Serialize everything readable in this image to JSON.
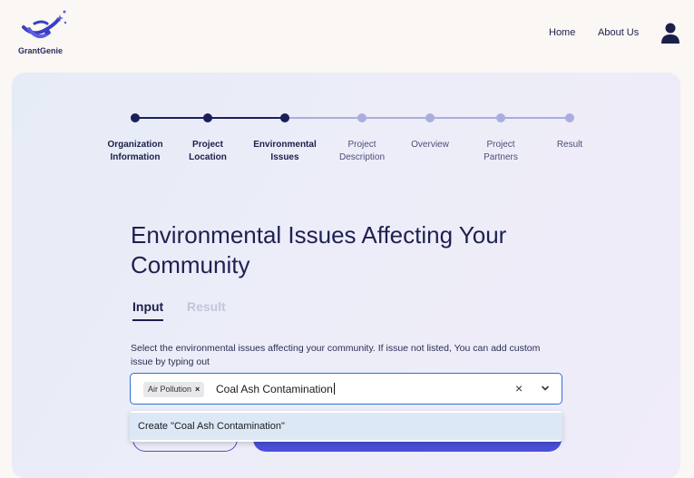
{
  "brand": {
    "name": "GrantGenie"
  },
  "nav": {
    "home": "Home",
    "about": "About Us"
  },
  "steps": [
    {
      "line1": "Organization",
      "line2": "Information",
      "status": "done"
    },
    {
      "line1": "Project",
      "line2": "Location",
      "status": "done"
    },
    {
      "line1": "Environmental",
      "line2": "Issues",
      "status": "done"
    },
    {
      "line1": "Project",
      "line2": "Description",
      "status": "todo"
    },
    {
      "line1": "Overview",
      "line2": "",
      "status": "todo"
    },
    {
      "line1": "Project",
      "line2": "Partners",
      "status": "todo"
    },
    {
      "line1": "Result",
      "line2": "",
      "status": "todo"
    }
  ],
  "page": {
    "heading": "Environmental Issues Affecting Your Community",
    "tabs": {
      "input": "Input",
      "result": "Result"
    },
    "instructions": "Select the environmental issues affecting your community. If issue not listed, You can add custom issue by typing out"
  },
  "select": {
    "selected_chips": [
      "Air Pollution"
    ],
    "typed_value": "Coal Ash Contamination",
    "clear_icon": "close-icon",
    "dropdown_icon": "chevron-down-icon"
  },
  "dropdown": {
    "option": "Create \"Coal Ash Contamination\""
  },
  "colors": {
    "accent": "#4a4fd8",
    "focus": "#2f6fd6",
    "step_done": "#1a1f5c",
    "step_todo": "#a9aede"
  }
}
